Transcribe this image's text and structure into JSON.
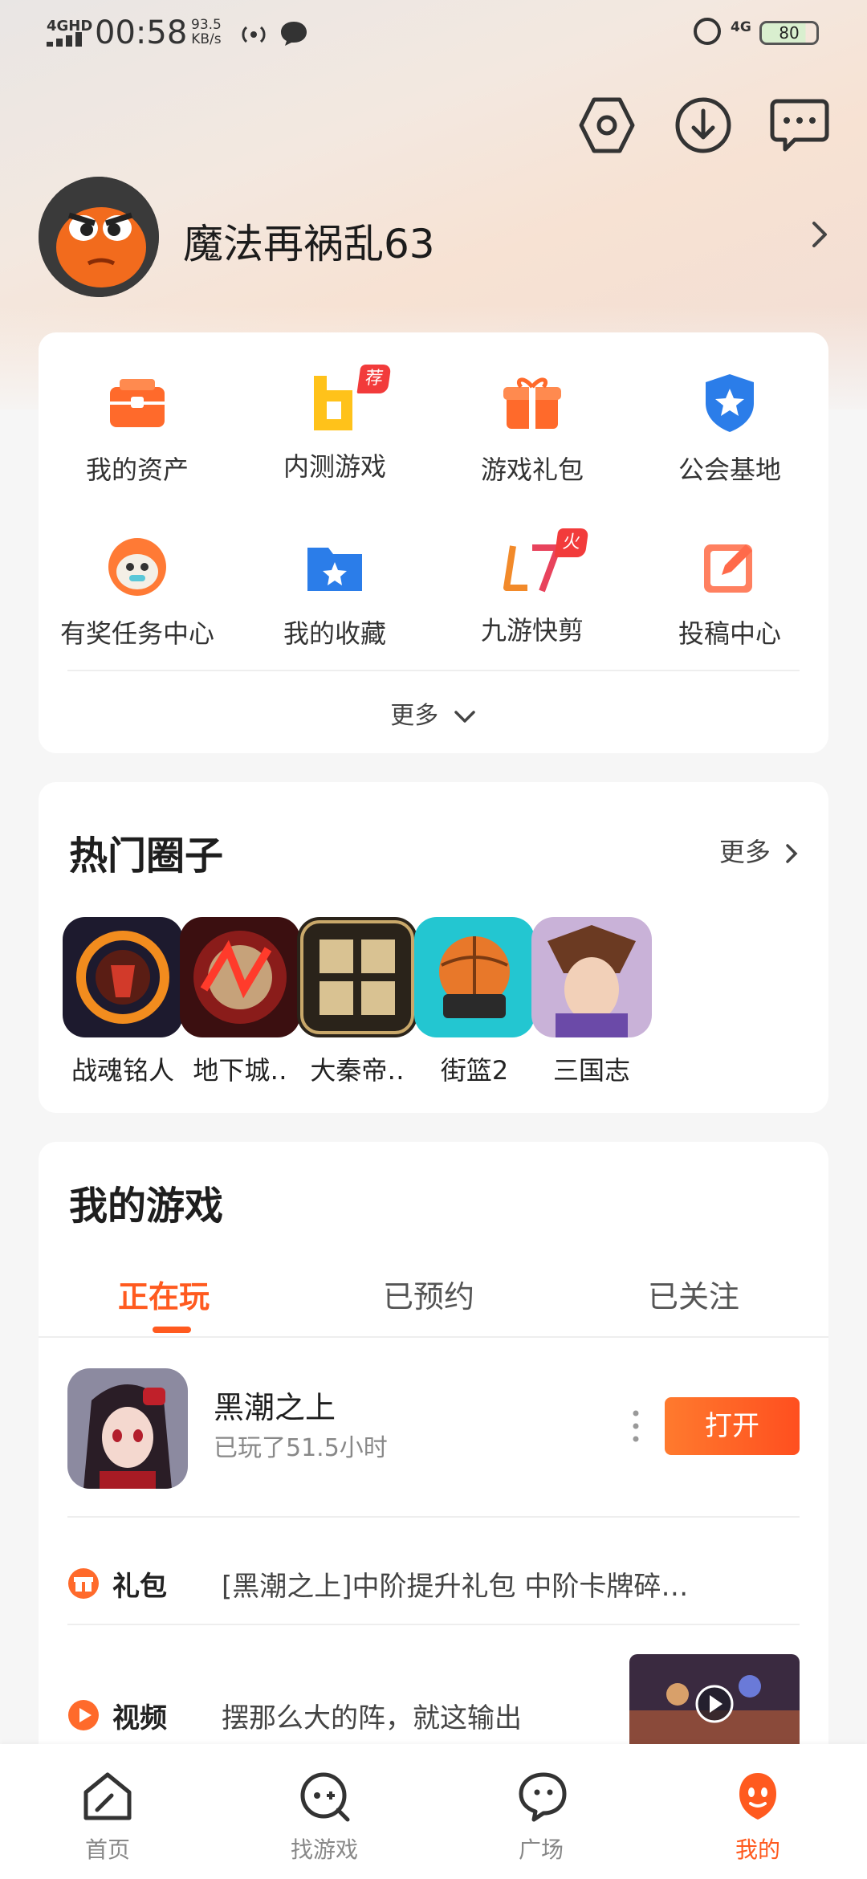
{
  "status_bar": {
    "network": "4GHD",
    "time": "00:58",
    "speed_value": "93.5",
    "speed_unit": "KB/s",
    "cell": "4G",
    "battery": "80"
  },
  "profile": {
    "username": "魔法再祸乱63"
  },
  "quick_grid": {
    "items": [
      {
        "label": "我的资产",
        "icon": "wallet-icon"
      },
      {
        "label": "内测游戏",
        "icon": "beta-game-icon",
        "tag": "荐"
      },
      {
        "label": "游戏礼包",
        "icon": "gift-icon"
      },
      {
        "label": "公会基地",
        "icon": "guild-shield-icon"
      },
      {
        "label": "有奖任务中心",
        "icon": "task-center-icon"
      },
      {
        "label": "我的收藏",
        "icon": "favorites-folder-icon"
      },
      {
        "label": "九游快剪",
        "icon": "quick-edit-icon",
        "tag": "火"
      },
      {
        "label": "投稿中心",
        "icon": "submit-edit-icon"
      }
    ],
    "more_label": "更多"
  },
  "hot_circles": {
    "title": "热门圈子",
    "more_label": "更多",
    "items": [
      {
        "label": "战魂铭人"
      },
      {
        "label": "地下城‥"
      },
      {
        "label": "大秦帝‥"
      },
      {
        "label": "街篮2"
      },
      {
        "label": "三国志"
      }
    ]
  },
  "my_games": {
    "title": "我的游戏",
    "tabs": [
      "正在玩",
      "已预约",
      "已关注"
    ],
    "active_tab": 0,
    "game": {
      "name": "黑潮之上",
      "played": "已玩了51.5小时",
      "open_label": "打开"
    },
    "gift_row": {
      "label": "礼包",
      "text": "[黑潮之上]中阶提升礼包 中阶卡牌碎…"
    },
    "video_row": {
      "label": "视频",
      "text": "摆那么大的阵，就这输出"
    }
  },
  "bottom_nav": {
    "items": [
      {
        "label": "首页",
        "icon": "home-icon"
      },
      {
        "label": "找游戏",
        "icon": "find-game-icon"
      },
      {
        "label": "广场",
        "icon": "plaza-icon"
      },
      {
        "label": "我的",
        "icon": "mine-icon"
      }
    ],
    "active": 3
  },
  "colors": {
    "accent": "#ff5a1f",
    "tag_red": "#f23b3b"
  }
}
